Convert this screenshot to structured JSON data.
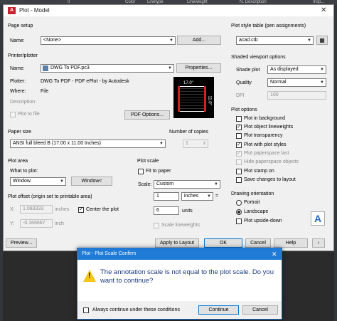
{
  "top_strip": {
    "items": [
      "0",
      "Color",
      "Linetype",
      "Lineweight",
      "N. Description",
      "Insp..."
    ]
  },
  "window": {
    "title": "Plot - Model",
    "close_glyph": "✕",
    "app_icon_text": "A"
  },
  "page_setup": {
    "header": "Page setup",
    "name_label": "Name:",
    "name_value": "<None>",
    "add_button": "Add..."
  },
  "printer": {
    "header": "Printer/plotter",
    "name_label": "Name:",
    "name_value": "DWG To PDF.pc3",
    "properties_button": "Properties...",
    "plotter_label": "Plotter:",
    "plotter_value": "DWG To PDF - PDF ePlot - by Autodesk",
    "where_label": "Where:",
    "where_value": "File",
    "description_label": "Description:",
    "plot_to_file_label": "Plot to file",
    "pdf_options_button": "PDF Options...",
    "preview_width_label": "17.0\"",
    "preview_height_label": "11.0\""
  },
  "paper_size": {
    "header": "Paper size",
    "value": "ANSI full bleed B (17.00 x 11.00 Inches)"
  },
  "copies": {
    "header": "Number of copies",
    "value": "1"
  },
  "plot_area": {
    "header": "Plot area",
    "what_label": "What to plot:",
    "what_value": "Window",
    "window_button": "Window<"
  },
  "plot_offset": {
    "header": "Plot offset (origin set to printable area)",
    "x_label": "X:",
    "x_value": "1.083333",
    "x_unit": "inches",
    "y_label": "Y:",
    "y_value": "-0.166667",
    "y_unit": "inch",
    "center_label": "Center the plot",
    "center_checked": true
  },
  "plot_scale": {
    "header": "Plot scale",
    "fit_label": "Fit to paper",
    "scale_label": "Scale:",
    "scale_value": "Custom",
    "value1": "1",
    "unit1": "inches",
    "equals": "=",
    "value2": "6",
    "unit2": "units",
    "scale_lw_label": "Scale lineweights"
  },
  "plot_style": {
    "header": "Plot style table (pen assignments)",
    "value": "acad.ctb",
    "edit_glyph": "▦"
  },
  "shaded": {
    "header": "Shaded viewport options",
    "shade_label": "Shade plot",
    "shade_value": "As displayed",
    "quality_label": "Quality",
    "quality_value": "Normal",
    "dpi_label": "DPI",
    "dpi_value": "100"
  },
  "plot_options": {
    "header": "Plot options",
    "items": [
      {
        "label": "Plot in background",
        "checked": false,
        "disabled": false
      },
      {
        "label": "Plot object lineweights",
        "checked": true,
        "disabled": false
      },
      {
        "label": "Plot transparency",
        "checked": false,
        "disabled": false
      },
      {
        "label": "Plot with plot styles",
        "checked": true,
        "disabled": false
      },
      {
        "label": "Plot paperspace last",
        "checked": true,
        "disabled": true
      },
      {
        "label": "Hide paperspace objects",
        "checked": false,
        "disabled": true
      },
      {
        "label": "Plot stamp on",
        "checked": false,
        "disabled": false
      },
      {
        "label": "Save changes to layout",
        "checked": false,
        "disabled": false
      }
    ]
  },
  "orientation": {
    "header": "Drawing orientation",
    "portrait": "Portrait",
    "landscape": "Landscape",
    "upside_down": "Plot upside-down",
    "selected": "landscape",
    "icon_letter": "A"
  },
  "footer": {
    "preview_button": "Preview...",
    "apply_button": "Apply to Layout",
    "ok_button": "OK",
    "cancel_button": "Cancel",
    "help_button": "Help"
  },
  "confirm_dialog": {
    "title": "Plot - Plot Scale Confirm",
    "close_glyph": "✕",
    "message": "The annotation scale is not equal to the plot scale. Do you want to continue?",
    "always_label": "Always continue under these conditions",
    "continue_button": "Continue",
    "cancel_button": "Cancel",
    "warn_glyph": "!"
  },
  "colors": {
    "accent": "#1f7bd6",
    "warning": "#f5c518",
    "brand": "#c8202e"
  }
}
